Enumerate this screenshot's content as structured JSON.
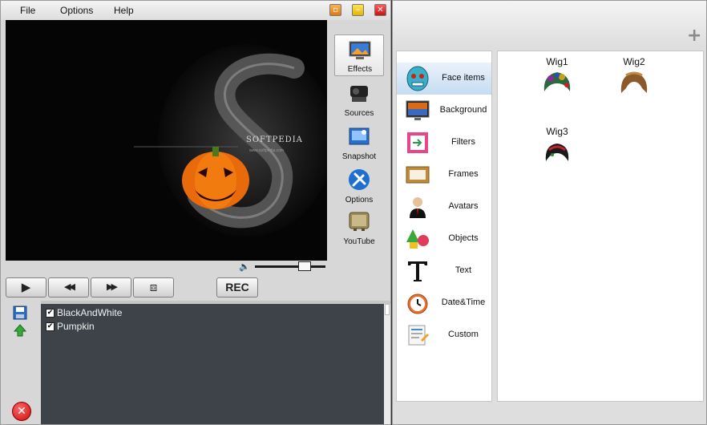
{
  "menu": {
    "file": "File",
    "options": "Options",
    "help": "Help"
  },
  "window_buttons": {
    "restore": "▫",
    "minimize": "–",
    "close": "✕"
  },
  "preview": {
    "brand": "SOFTPEDIA",
    "brand_sub": "www.softpedia.com"
  },
  "side_tools": [
    {
      "label": "Effects",
      "icon": "effects-icon"
    },
    {
      "label": "Sources",
      "icon": "sources-icon"
    },
    {
      "label": "Snapshot",
      "icon": "snapshot-icon"
    },
    {
      "label": "Options",
      "icon": "options-icon"
    },
    {
      "label": "YouTube",
      "icon": "youtube-icon"
    }
  ],
  "volume": {
    "level": 0.7
  },
  "controls": {
    "play": "▶",
    "rewind": "◀◀",
    "forward": "▶▶",
    "snapshot": "⧈",
    "rec": "REC"
  },
  "effects_list": [
    {
      "label": "BlackAndWhite",
      "checked": true,
      "check": "✔"
    },
    {
      "label": "Pumpkin",
      "checked": true,
      "check": "✔"
    }
  ],
  "delete_label": "✕",
  "plus_label": "+",
  "categories": [
    {
      "label": "Face items",
      "active": true
    },
    {
      "label": "Background"
    },
    {
      "label": "Filters"
    },
    {
      "label": "Frames"
    },
    {
      "label": "Avatars"
    },
    {
      "label": "Objects"
    },
    {
      "label": "Text"
    },
    {
      "label": "Date&Time"
    },
    {
      "label": "Custom"
    }
  ],
  "gallery": [
    {
      "label": "Wig1"
    },
    {
      "label": "Wig2"
    },
    {
      "label": "Wig3"
    }
  ],
  "colors": {
    "accent": "#c6dcf2",
    "list_bg": "#3d4349",
    "preview_bg": "#050505"
  }
}
